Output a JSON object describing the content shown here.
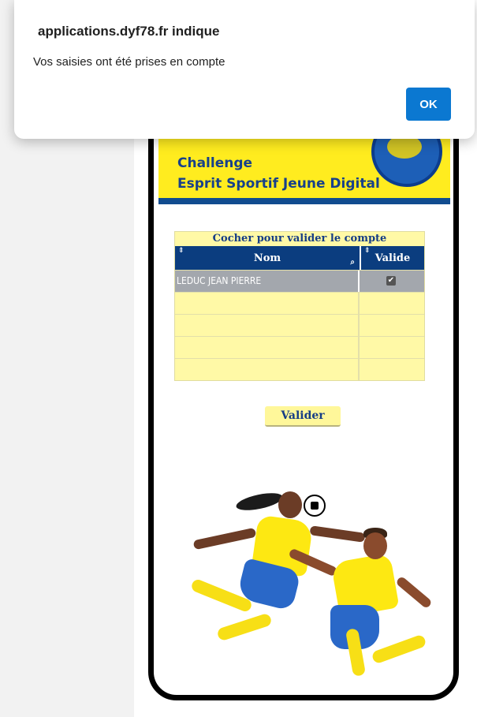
{
  "dialog": {
    "title": "applications.dyf78.fr indique",
    "message": "Vos saisies ont été prises en compte",
    "ok_label": "OK"
  },
  "banner": {
    "line1": "Challenge",
    "line2": "Esprit Sportif Jeune Digital"
  },
  "table": {
    "caption": "Cocher pour valider le compte",
    "sort_glyph": "⇕",
    "search_glyph": "⌕",
    "columns": [
      "Nom",
      "Valide"
    ],
    "rows": [
      {
        "nom": "LEDUC JEAN PIERRE",
        "valide": true,
        "check_glyph": "✔"
      }
    ]
  },
  "buttons": {
    "valider_label": "Valider"
  },
  "colors": {
    "banner_yellow": "#ffec1f",
    "header_blue": "#0b3d7f",
    "ok_blue": "#0b78d1",
    "row_selected": "#a3a7ad",
    "row_empty": "#fff9a6"
  }
}
